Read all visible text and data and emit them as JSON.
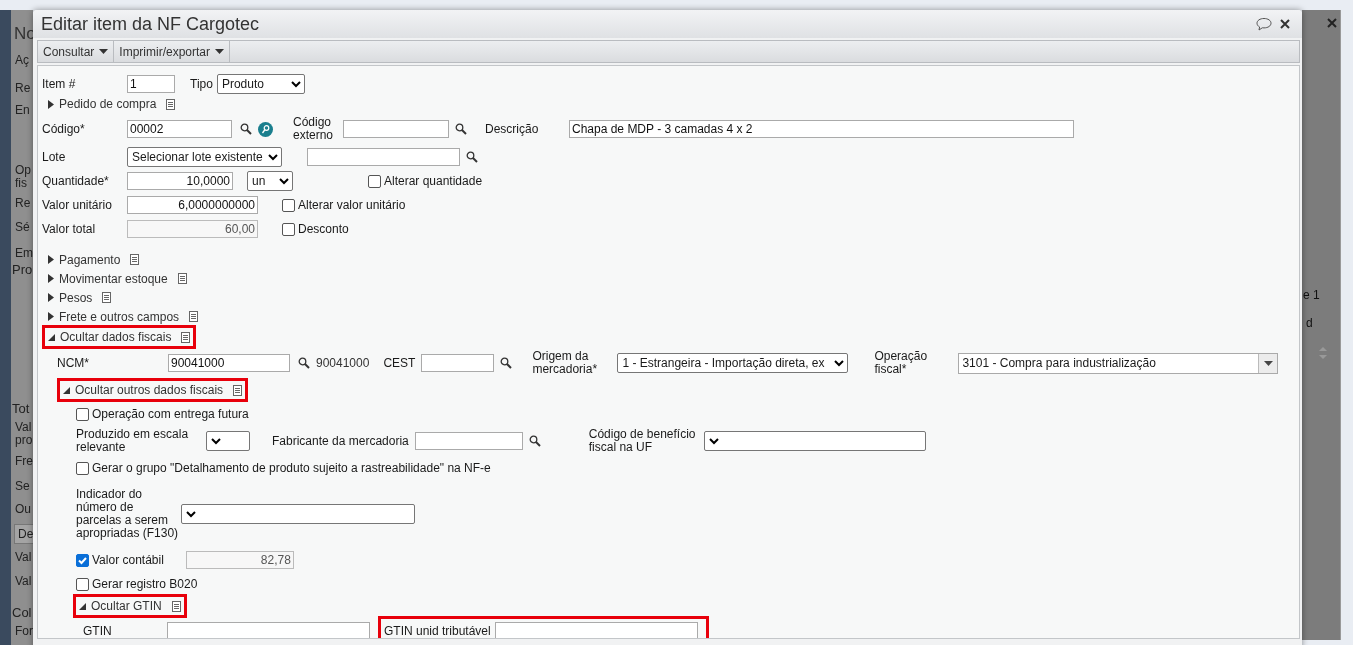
{
  "background": {
    "left_texts": [
      {
        "text": "No",
        "kind": "title"
      },
      {
        "text": "Aç",
        "kind": "tab"
      },
      {
        "text": "Re",
        "kind": "text"
      },
      {
        "text": "En",
        "kind": "text"
      },
      {
        "text": "Op",
        "kind": "text"
      },
      {
        "text": "fis",
        "kind": "text"
      },
      {
        "text": "Re",
        "kind": "text"
      },
      {
        "text": "Sé",
        "kind": "text"
      },
      {
        "text": "Em",
        "kind": "text"
      },
      {
        "text": "Pro",
        "kind": "heading"
      },
      {
        "text": "Tot",
        "kind": "heading"
      },
      {
        "text": "Val",
        "kind": "text"
      },
      {
        "text": "pro",
        "kind": "text"
      },
      {
        "text": "Fre",
        "kind": "text"
      },
      {
        "text": "Se",
        "kind": "text"
      },
      {
        "text": "Ou",
        "kind": "text"
      },
      {
        "text": "De",
        "kind": "button"
      },
      {
        "text": "Val",
        "kind": "text"
      },
      {
        "text": "Val",
        "kind": "text"
      },
      {
        "text": "Col",
        "kind": "heading"
      },
      {
        "text": "For",
        "kind": "text"
      }
    ],
    "right_texts": [
      "e 1",
      "d"
    ]
  },
  "dialog": {
    "title": "Editar item da NF Cargotec"
  },
  "toolbar": [
    {
      "label": "Consultar"
    },
    {
      "label": "Imprimir/exportar"
    }
  ],
  "form": {
    "item_number": {
      "label": "Item #",
      "value": "1"
    },
    "tipo": {
      "label": "Tipo",
      "value": "Produto"
    },
    "pedido": {
      "label": "Pedido de compra",
      "expanded": false
    },
    "codigo": {
      "label": "Código*",
      "value": "00002"
    },
    "codigo_externo": {
      "label": "Código externo"
    },
    "descricao": {
      "label": "Descrição",
      "value": "Chapa de MDP - 3 camadas 4 x 2"
    },
    "lote": {
      "label": "Lote",
      "value": "Selecionar lote existente"
    },
    "quantidade": {
      "label": "Quantidade*",
      "value": "10,0000",
      "unit": "un"
    },
    "alterar_quantidade": {
      "label": "Alterar quantidade",
      "checked": false
    },
    "valor_unitario": {
      "label": "Valor unitário",
      "value": "6,0000000000"
    },
    "alterar_valor_unitario": {
      "label": "Alterar valor unitário",
      "checked": false
    },
    "valor_total": {
      "label": "Valor total",
      "value": "60,00",
      "disabled": true
    },
    "desconto": {
      "label": "Desconto",
      "checked": false
    },
    "sections": [
      {
        "label": "Pagamento",
        "expanded": false,
        "highlighted": false
      },
      {
        "label": "Movimentar estoque",
        "expanded": false,
        "highlighted": false
      },
      {
        "label": "Pesos",
        "expanded": false,
        "highlighted": false
      },
      {
        "label": "Frete e outros campos",
        "expanded": false,
        "highlighted": false
      }
    ],
    "fiscal": {
      "label": "Ocultar dados fiscais",
      "expanded": true,
      "highlighted": true
    },
    "ncm": {
      "label": "NCM*",
      "value": "90041000",
      "code": "90041000"
    },
    "cest": {
      "label": "CEST"
    },
    "origem": {
      "label": "Origem da mercadoria*",
      "value": "1 - Estrangeira - Importação direta, ex"
    },
    "operacao_fiscal": {
      "label": "Operação fiscal*",
      "value": "3101 - Compra para industrialização"
    },
    "outros": {
      "label": "Ocultar outros dados fiscais",
      "expanded": true,
      "highlighted": true
    },
    "entrega_futura": {
      "label": "Operação com entrega futura",
      "checked": false
    },
    "escala": {
      "label": "Produzido em escala relevante"
    },
    "fabricante": {
      "label": "Fabricante da mercadoria"
    },
    "beneficio": {
      "label": "Código de benefício fiscal na UF"
    },
    "rastreabilidade": {
      "label": "Gerar o grupo \"Detalhamento de produto sujeito a rastreabilidade\" na NF-e",
      "checked": false
    },
    "indicador": {
      "label": "Indicador do número de parcelas a serem apropriadas (F130)"
    },
    "valor_contabil": {
      "label": "Valor contábil",
      "checked": true,
      "value": "82,78",
      "disabled": true
    },
    "b020": {
      "label": "Gerar registro B020",
      "checked": false
    },
    "gtin_section": {
      "label": "Ocultar GTIN",
      "expanded": true,
      "highlighted": true
    },
    "gtin": {
      "label": "GTIN"
    },
    "gtin_unid": {
      "label": "GTIN unid tributável",
      "highlighted": true
    }
  }
}
